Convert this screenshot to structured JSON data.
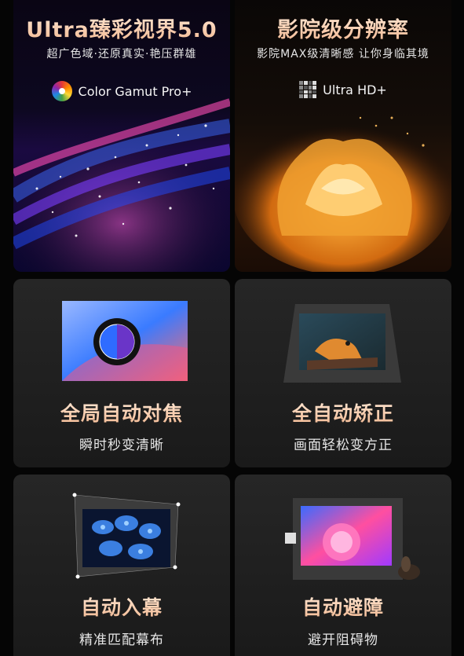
{
  "panels": {
    "color": {
      "title": "Ultra臻彩视界5.0",
      "subtitle": "超广色域·还原真实·艳压群雄",
      "badge_icon": "rainbow-gamut-icon",
      "badge_label": "Color Gamut Pro+"
    },
    "resolution": {
      "title": "影院级分辨率",
      "subtitle": "影院MAX级清晰感 让你身临其境",
      "badge_icon": "pixel-grid-icon",
      "badge_label": "Ultra HD+"
    }
  },
  "features": [
    {
      "title": "全局自动对焦",
      "subtitle": "瞬时秒变清晰",
      "icon": "autofocus-lens-icon"
    },
    {
      "title": "全自动矫正",
      "subtitle": "画面轻松变方正",
      "icon": "keystone-correction-icon"
    },
    {
      "title": "自动入幕",
      "subtitle": "精准匹配幕布",
      "icon": "screen-fit-icon"
    },
    {
      "title": "自动避障",
      "subtitle": "避开阻碍物",
      "icon": "obstacle-avoid-icon"
    }
  ],
  "colors": {
    "title_gradient_top": "#ffe9d6",
    "title_gradient_bottom": "#f2b891",
    "background": "#050505"
  }
}
